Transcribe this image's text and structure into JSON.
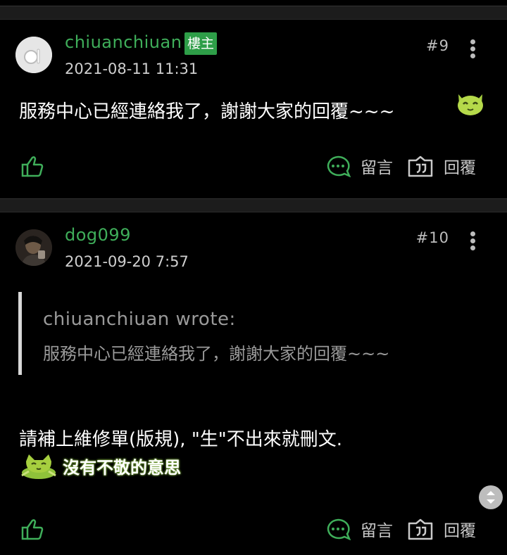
{
  "colors": {
    "accent_green": "#3fae5a",
    "badge_green": "#2e9e48",
    "background": "#000000"
  },
  "posts": [
    {
      "username": "chiuanchiuan",
      "op_badge": "樓主",
      "timestamp": "2021-08-11 11:31",
      "floor": "#9",
      "text": "服務中心已經連絡我了，謝謝大家的回覆~~~",
      "emoji": "green-cat-smile-emoji",
      "actions": {
        "comment": "留言",
        "reply": "回覆"
      }
    },
    {
      "username": "dog099",
      "timestamp": "2021-09-20 7:57",
      "floor": "#10",
      "quote": {
        "author": "chiuanchiuan wrote:",
        "text": "服務中心已經連絡我了，謝謝大家的回覆~~~"
      },
      "text": "請補上維修單(版規), \"生\"不出來就刪文.",
      "emoji_line": "沒有不敬的意思",
      "actions": {
        "comment": "留言",
        "reply": "回覆"
      }
    }
  ]
}
